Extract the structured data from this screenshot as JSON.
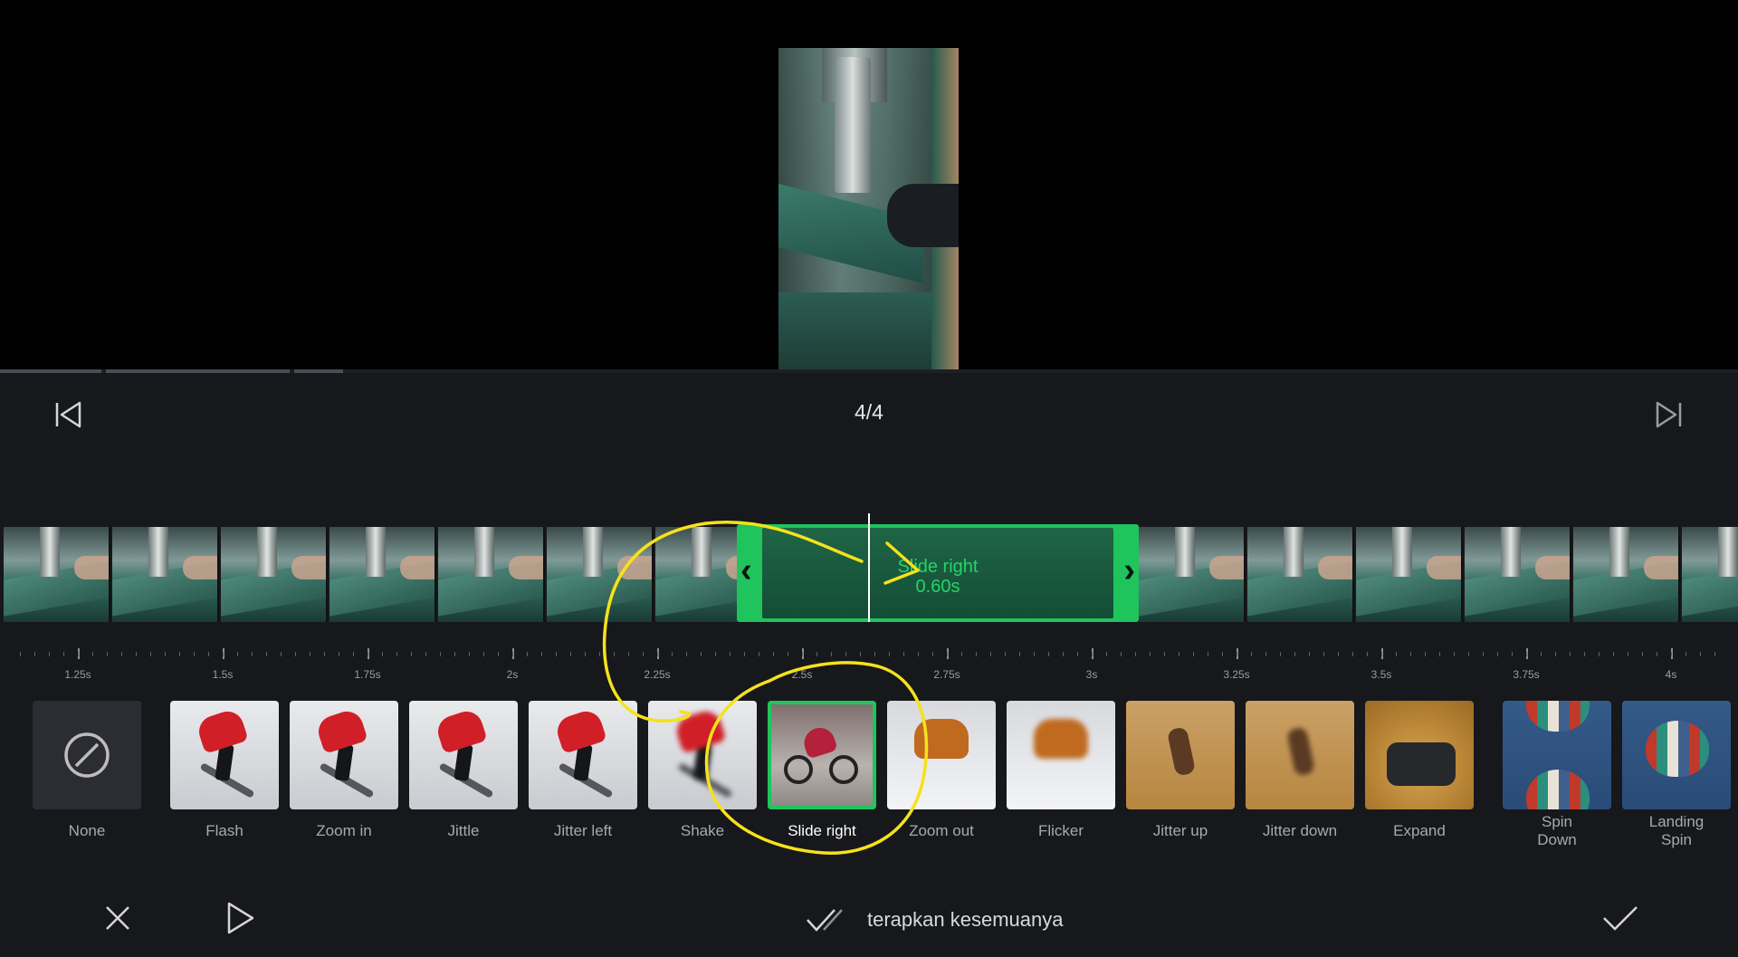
{
  "clip_counter": "4/4",
  "transition": {
    "name": "Slide right",
    "duration": "0.60s"
  },
  "ruler_labels": [
    "1.25s",
    "1.5s",
    "1.75s",
    "2s",
    "2.25s",
    "2.5s",
    "2.75s",
    "3s",
    "3.25s",
    "3.5s",
    "3.75s",
    "4s"
  ],
  "effects": [
    {
      "label": "None",
      "icon": "none-icon"
    },
    {
      "label": "Flash"
    },
    {
      "label": "Zoom in"
    },
    {
      "label": "Jittle"
    },
    {
      "label": "Jitter left"
    },
    {
      "label": "Shake"
    },
    {
      "label": "Slide right",
      "selected": true
    },
    {
      "label": "Zoom out"
    },
    {
      "label": "Flicker"
    },
    {
      "label": "Jitter up"
    },
    {
      "label": "Jitter down"
    },
    {
      "label": "Expand"
    },
    {
      "label": "Spin\nDown"
    },
    {
      "label": "Landing\nSpin"
    }
  ],
  "bottom_bar": {
    "apply_all_label": "terapkan kesemuanya"
  },
  "colors": {
    "accent": "#1fc45c",
    "annotation": "#f5e21b",
    "panel_bg": "#17181c"
  }
}
